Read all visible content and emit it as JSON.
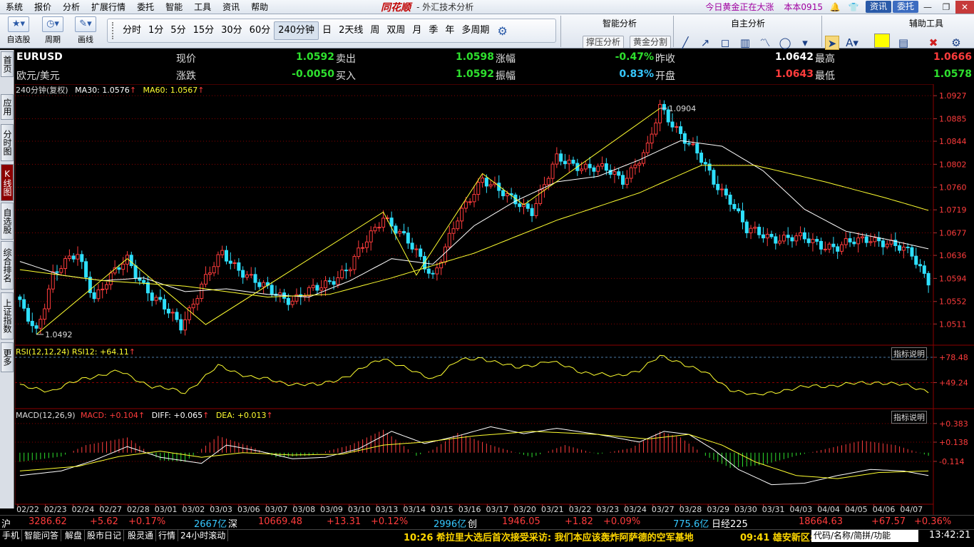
{
  "menubar": {
    "items": [
      "系统",
      "报价",
      "分析",
      "扩展行情",
      "委托",
      "智能",
      "工具",
      "资讯",
      "帮助"
    ],
    "brand": "同花顺",
    "app_title": "- 外汇技术分析",
    "news": "今日黄金正在大涨",
    "version": "本本0915",
    "tab_news": "资讯",
    "tab_trade": "委托"
  },
  "toolbar": {
    "left_buttons": [
      "自选股",
      "周期",
      "画线"
    ],
    "periods": [
      "分时",
      "1分",
      "5分",
      "15分",
      "30分",
      "60分",
      "240分钟",
      "日",
      "2天线",
      "周",
      "双周",
      "月",
      "季",
      "年",
      "多周期"
    ],
    "active_period": "240分钟",
    "panel_smart": "智能分析",
    "btn_support": "撑压分析",
    "btn_gold": "黄金分割",
    "panel_self": "自主分析",
    "panel_aux": "辅助工具"
  },
  "side_tabs": [
    "首页",
    "应用",
    "分时图",
    "K线图",
    "自选股",
    "综合排名",
    "上证指数",
    "更多"
  ],
  "side_active": "K线图",
  "info": {
    "symbol": "EURUSD",
    "name": "欧元/美元",
    "labels": {
      "now": "现价",
      "sell": "卖出",
      "pct": "涨幅",
      "prev": "昨收",
      "high": "最高",
      "chg": "涨跌",
      "buy": "买入",
      "amp": "振幅",
      "open": "开盘",
      "low": "最低"
    },
    "now": "1.0592",
    "sell": "1.0598",
    "pct": "-0.47%",
    "prev": "1.0642",
    "high": "1.0666",
    "chg": "-0.0050",
    "buy": "1.0592",
    "amp": "0.83%",
    "open": "1.0643",
    "low": "1.0578"
  },
  "legends": {
    "main_prefix": "240分钟(复权)",
    "ma30": "MA30: 1.0576",
    "ma60": "MA60: 1.0567",
    "rsi": "RSI(12,12,24)  RSI12: +64.11",
    "macd_name": "MACD(12,26,9)",
    "macd": "MACD: +0.104",
    "diff": "DIFF: +0.065",
    "dea": "DEA: +0.013",
    "indicator_help": "指标说明"
  },
  "chart_data": {
    "type": "candlestick",
    "title": "EURUSD 240分钟",
    "price_axis": {
      "ylim": [
        1.0475,
        1.0935
      ],
      "ticks": [
        "1.0927",
        "1.0885",
        "1.0844",
        "1.0802",
        "1.0760",
        "1.0719",
        "1.0677",
        "1.0636",
        "1.0594",
        "1.0552",
        "1.0511"
      ]
    },
    "annotations": {
      "high": "1.0904",
      "low": "1.0492"
    },
    "dates": [
      "02/22",
      "02/23",
      "02/24",
      "02/27",
      "02/28",
      "03/01",
      "03/02",
      "03/03",
      "03/06",
      "03/07",
      "03/08",
      "03/09",
      "03/10",
      "03/13",
      "03/14",
      "03/15",
      "03/16",
      "03/17",
      "03/20",
      "03/21",
      "03/22",
      "03/23",
      "03/24",
      "03/27",
      "03/28",
      "03/29",
      "03/30",
      "03/31",
      "04/03",
      "04/04",
      "04/05",
      "04/06",
      "04/07"
    ],
    "close_path": [
      [
        0,
        1.0545
      ],
      [
        4,
        1.05
      ],
      [
        8,
        1.06
      ],
      [
        14,
        1.064
      ],
      [
        18,
        1.056
      ],
      [
        26,
        1.063
      ],
      [
        32,
        1.056
      ],
      [
        39,
        1.051
      ],
      [
        44,
        1.058
      ],
      [
        49,
        1.064
      ],
      [
        58,
        1.058
      ],
      [
        66,
        1.0555
      ],
      [
        72,
        1.0575
      ],
      [
        80,
        1.0615
      ],
      [
        88,
        1.071
      ],
      [
        96,
        1.064
      ],
      [
        100,
        1.06
      ],
      [
        106,
        1.07
      ],
      [
        112,
        1.078
      ],
      [
        118,
        1.074
      ],
      [
        124,
        1.072
      ],
      [
        130,
        1.081
      ],
      [
        136,
        1.08
      ],
      [
        142,
        1.079
      ],
      [
        146,
        1.0775
      ],
      [
        152,
        1.083
      ],
      [
        155,
        1.0904
      ],
      [
        160,
        1.086
      ],
      [
        164,
        1.082
      ],
      [
        168,
        1.077
      ],
      [
        172,
        1.074
      ],
      [
        176,
        1.068
      ],
      [
        182,
        1.067
      ],
      [
        190,
        1.0665
      ],
      [
        198,
        1.065
      ],
      [
        206,
        1.067
      ],
      [
        212,
        1.065
      ],
      [
        216,
        1.064
      ],
      [
        220,
        1.0592
      ]
    ],
    "ma30_path": [
      [
        0,
        1.0625
      ],
      [
        10,
        1.06
      ],
      [
        20,
        1.059
      ],
      [
        30,
        1.0595
      ],
      [
        40,
        1.057
      ],
      [
        50,
        1.0575
      ],
      [
        60,
        1.0565
      ],
      [
        70,
        1.056
      ],
      [
        80,
        1.059
      ],
      [
        90,
        1.063
      ],
      [
        100,
        1.062
      ],
      [
        110,
        1.069
      ],
      [
        120,
        1.0735
      ],
      [
        130,
        1.077
      ],
      [
        140,
        1.078
      ],
      [
        150,
        1.081
      ],
      [
        160,
        1.0845
      ],
      [
        170,
        1.0835
      ],
      [
        180,
        1.079
      ],
      [
        190,
        1.072
      ],
      [
        200,
        1.068
      ],
      [
        210,
        1.0665
      ],
      [
        220,
        1.0648
      ]
    ],
    "ma60_path": [
      [
        0,
        1.061
      ],
      [
        20,
        1.059
      ],
      [
        40,
        1.058
      ],
      [
        60,
        1.056
      ],
      [
        75,
        1.0565
      ],
      [
        90,
        1.0595
      ],
      [
        110,
        1.064
      ],
      [
        130,
        1.07
      ],
      [
        150,
        1.075
      ],
      [
        165,
        1.08
      ],
      [
        178,
        1.08
      ],
      [
        195,
        1.077
      ],
      [
        210,
        1.074
      ],
      [
        220,
        1.0718
      ]
    ],
    "zigzag": [
      [
        4,
        1.0492
      ],
      [
        26,
        1.063
      ],
      [
        45,
        1.051
      ],
      [
        88,
        1.0715
      ],
      [
        96,
        1.06
      ],
      [
        112,
        1.0785
      ],
      [
        122,
        1.0728
      ],
      [
        155,
        1.0904
      ]
    ],
    "rsi": {
      "ylim": [
        20,
        90
      ],
      "ticks": [
        "+78.48",
        "+49.24"
      ],
      "path": [
        [
          0,
          45
        ],
        [
          8,
          40
        ],
        [
          16,
          55
        ],
        [
          24,
          62
        ],
        [
          32,
          45
        ],
        [
          40,
          38
        ],
        [
          48,
          68
        ],
        [
          56,
          56
        ],
        [
          64,
          49
        ],
        [
          72,
          46
        ],
        [
          80,
          58
        ],
        [
          88,
          78
        ],
        [
          96,
          60
        ],
        [
          100,
          54
        ],
        [
          106,
          74
        ],
        [
          112,
          78
        ],
        [
          120,
          66
        ],
        [
          128,
          74
        ],
        [
          136,
          62
        ],
        [
          144,
          56
        ],
        [
          150,
          64
        ],
        [
          155,
          79
        ],
        [
          160,
          73
        ],
        [
          166,
          60
        ],
        [
          172,
          42
        ],
        [
          178,
          34
        ],
        [
          184,
          40
        ],
        [
          192,
          45
        ],
        [
          200,
          47
        ],
        [
          208,
          50
        ],
        [
          214,
          46
        ],
        [
          220,
          40
        ]
      ]
    },
    "macd": {
      "ylim": [
        -0.62,
        0.55
      ],
      "ticks": [
        "+0.383",
        "+0.138",
        "-0.114"
      ],
      "hist": [
        [
          0,
          -0.12
        ],
        [
          10,
          -0.05
        ],
        [
          16,
          0.1
        ],
        [
          26,
          0.2
        ],
        [
          34,
          -0.1
        ],
        [
          40,
          -0.12
        ],
        [
          48,
          0.22
        ],
        [
          56,
          0.08
        ],
        [
          62,
          -0.06
        ],
        [
          70,
          -0.04
        ],
        [
          80,
          0.1
        ],
        [
          88,
          0.3
        ],
        [
          96,
          -0.04
        ],
        [
          100,
          0.04
        ],
        [
          106,
          0.26
        ],
        [
          114,
          0.1
        ],
        [
          124,
          -0.06
        ],
        [
          132,
          0.1
        ],
        [
          140,
          -0.02
        ],
        [
          148,
          0.06
        ],
        [
          155,
          0.28
        ],
        [
          160,
          0.2
        ],
        [
          166,
          -0.04
        ],
        [
          172,
          -0.2
        ],
        [
          180,
          -0.16
        ],
        [
          188,
          -0.04
        ],
        [
          196,
          0.06
        ],
        [
          204,
          0.16
        ],
        [
          212,
          0.1
        ],
        [
          220,
          -0.04
        ]
      ],
      "diff": [
        [
          0,
          -0.3
        ],
        [
          10,
          -0.24
        ],
        [
          18,
          -0.1
        ],
        [
          26,
          0.08
        ],
        [
          34,
          -0.06
        ],
        [
          44,
          -0.14
        ],
        [
          50,
          0.1
        ],
        [
          58,
          0.02
        ],
        [
          66,
          -0.08
        ],
        [
          74,
          -0.06
        ],
        [
          82,
          0.05
        ],
        [
          90,
          0.28
        ],
        [
          98,
          0.12
        ],
        [
          106,
          0.22
        ],
        [
          114,
          0.34
        ],
        [
          122,
          0.25
        ],
        [
          130,
          0.32
        ],
        [
          140,
          0.24
        ],
        [
          150,
          0.14
        ],
        [
          156,
          0.28
        ],
        [
          162,
          0.24
        ],
        [
          168,
          0.04
        ],
        [
          174,
          -0.22
        ],
        [
          182,
          -0.42
        ],
        [
          190,
          -0.4
        ],
        [
          198,
          -0.3
        ],
        [
          206,
          -0.22
        ],
        [
          214,
          -0.24
        ],
        [
          220,
          -0.3
        ]
      ],
      "dea": [
        [
          0,
          -0.24
        ],
        [
          14,
          -0.18
        ],
        [
          24,
          -0.05
        ],
        [
          34,
          0.02
        ],
        [
          44,
          -0.06
        ],
        [
          54,
          0.0
        ],
        [
          66,
          -0.03
        ],
        [
          78,
          -0.02
        ],
        [
          88,
          0.1
        ],
        [
          98,
          0.14
        ],
        [
          110,
          0.22
        ],
        [
          124,
          0.28
        ],
        [
          140,
          0.24
        ],
        [
          152,
          0.18
        ],
        [
          162,
          0.24
        ],
        [
          170,
          0.1
        ],
        [
          178,
          -0.12
        ],
        [
          188,
          -0.3
        ],
        [
          198,
          -0.34
        ],
        [
          208,
          -0.26
        ],
        [
          220,
          -0.24
        ]
      ]
    }
  },
  "status1": {
    "sh_label": "沪",
    "sh_index": "3286.62",
    "sh_chg": "+5.62",
    "sh_pct": "+0.17%",
    "sh_amount": "2667亿",
    "sz_label": "深",
    "sz_index": "10669.48",
    "sz_chg": "+13.31",
    "sz_pct": "+0.12%",
    "sz_amount": "2996亿",
    "cy_label": "创",
    "cy_index": "1946.05",
    "cy_chg": "+1.82",
    "cy_pct": "+0.09%",
    "cy_amount": "775.6亿",
    "nk_label": "日经225",
    "nk_index": "18664.63",
    "nk_chg": "+67.57",
    "nk_pct": "+0.36%"
  },
  "status2": {
    "tabs": [
      "手机",
      "智能问答",
      "解盘",
      "股市日记",
      "股灵通",
      "行情",
      "24小时滚动"
    ],
    "news1": "10:26 希拉里大选后首次接受采访: 我们本应该轰炸阿萨德的空军基地",
    "news2": "09:41 雄安新区:",
    "search_placeholder": "代码/名称/简拼/功能",
    "clock": "13:42:21"
  },
  "colors": {
    "up": "#ff3c3c",
    "down": "#2ee0ff",
    "ma30": "#ffffff",
    "ma60": "#ffff30",
    "grid": "#8b0000"
  }
}
